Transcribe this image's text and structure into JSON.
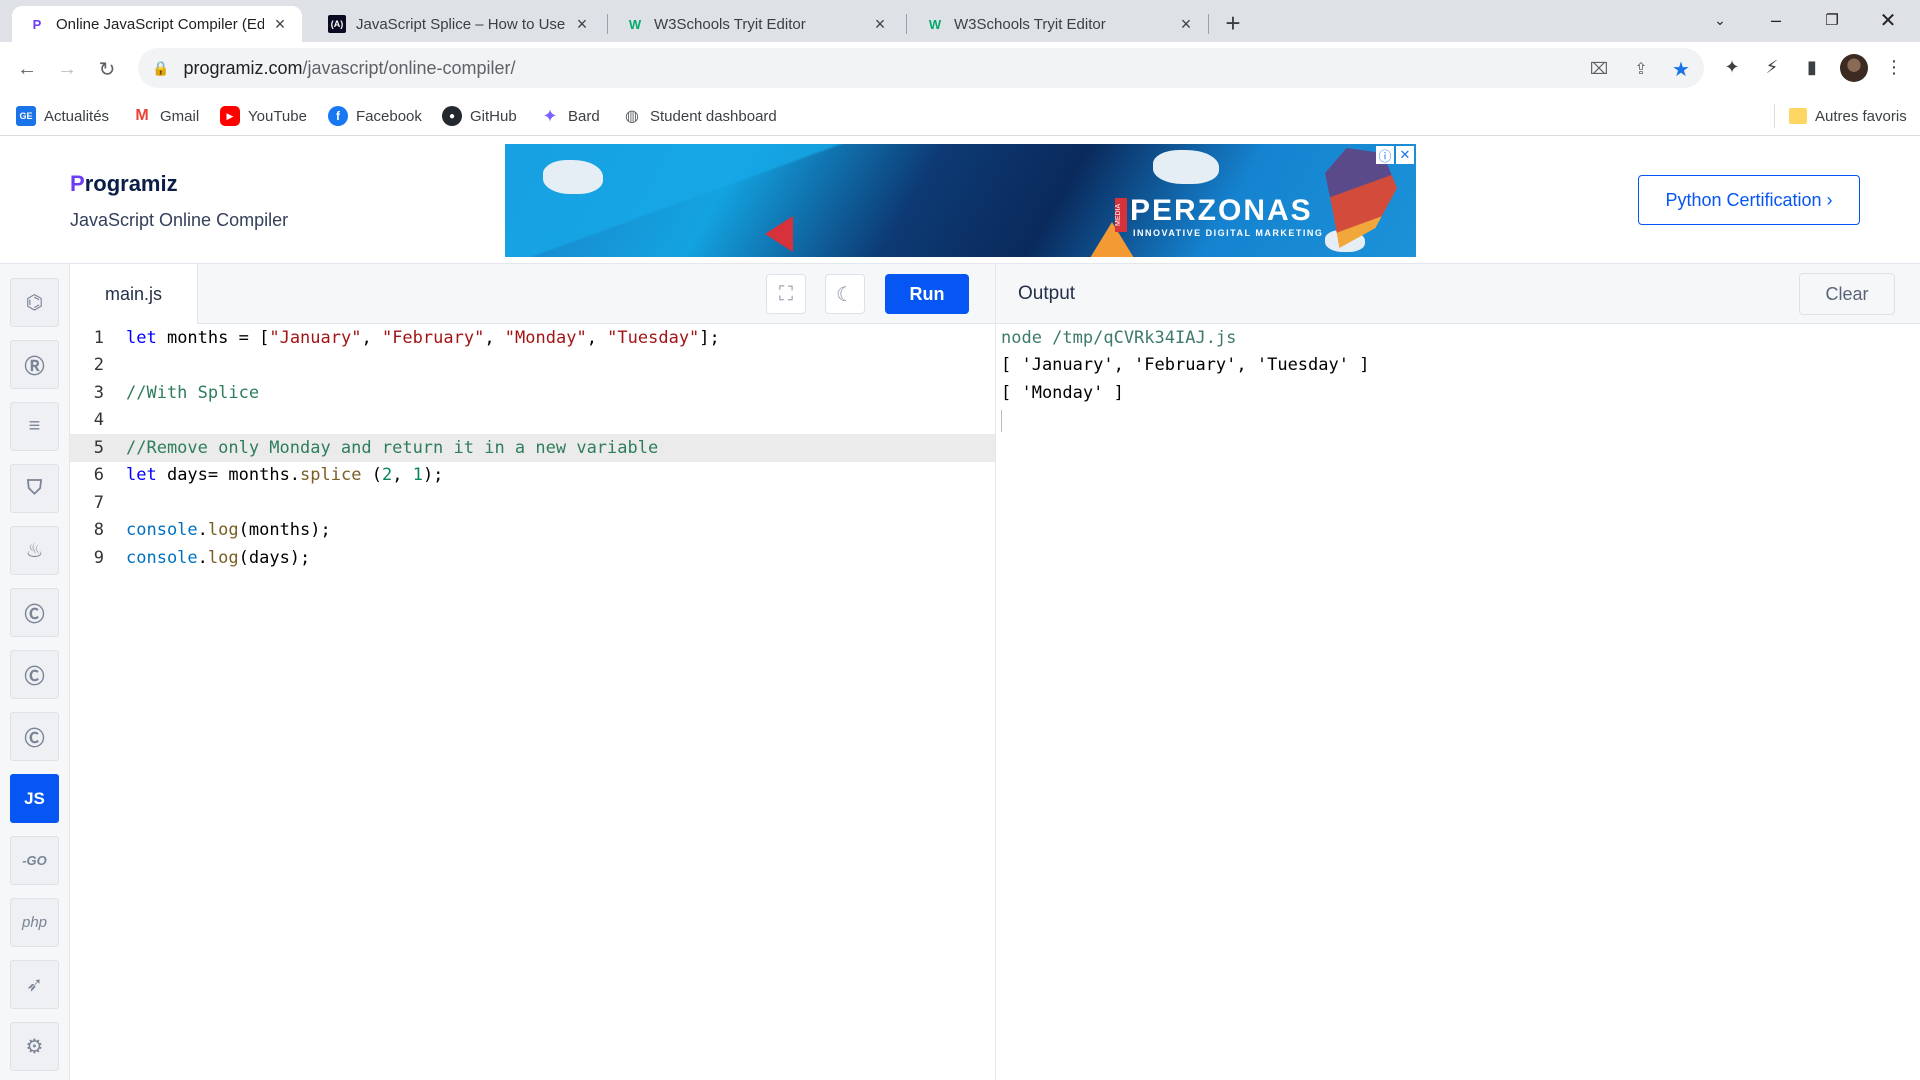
{
  "browser": {
    "tabs": [
      {
        "title": "Online JavaScript Compiler (Edito",
        "favicon": "P",
        "active": true
      },
      {
        "title": "JavaScript Splice – How to Use th",
        "favicon": "(A)",
        "active": false
      },
      {
        "title": "W3Schools Tryit Editor",
        "favicon": "W",
        "active": false
      },
      {
        "title": "W3Schools Tryit Editor",
        "favicon": "W",
        "active": false
      }
    ],
    "url_domain": "programiz.com",
    "url_path": "/javascript/online-compiler/",
    "bookmarks": [
      {
        "label": "Actualités",
        "icon": "news-icon",
        "color": "#1a73e8"
      },
      {
        "label": "Gmail",
        "icon": "gmail-icon",
        "color": "#ea4335"
      },
      {
        "label": "YouTube",
        "icon": "youtube-icon",
        "color": "#ff0000"
      },
      {
        "label": "Facebook",
        "icon": "facebook-icon",
        "color": "#1877f2"
      },
      {
        "label": "GitHub",
        "icon": "github-icon",
        "color": "#24292f"
      },
      {
        "label": "Bard",
        "icon": "bard-icon",
        "color": "#7b61ff"
      },
      {
        "label": "Student dashboard",
        "icon": "globe-icon",
        "color": "#5f6368"
      }
    ],
    "other_bookmarks": "Autres favoris"
  },
  "site": {
    "logo": "rogramiz",
    "logo_initial": "P",
    "subtitle": "JavaScript Online Compiler",
    "ad": {
      "brand": "PERZONAS",
      "tagline": "INNOVATIVE DIGITAL MARKETING",
      "media": "MEDIA"
    },
    "cert_button": "Python Certification ›"
  },
  "editor": {
    "file_name": "main.js",
    "run_label": "Run",
    "highlighted_line": 5,
    "lines": [
      "let months = [\"January\", \"February\", \"Monday\", \"Tuesday\"];",
      "",
      "//With Splice",
      "",
      "//Remove only Monday and return it in a new variable",
      "let days= months.splice (2, 1);",
      "",
      "console.log(months);",
      "console.log(days);"
    ]
  },
  "languages": [
    {
      "name": "python",
      "icon": "python-icon"
    },
    {
      "name": "r",
      "icon": "r-icon"
    },
    {
      "name": "sql",
      "icon": "database-icon"
    },
    {
      "name": "html",
      "icon": "html5-icon"
    },
    {
      "name": "java",
      "icon": "java-icon"
    },
    {
      "name": "c",
      "icon": "c-icon"
    },
    {
      "name": "cpp",
      "icon": "cpp-icon"
    },
    {
      "name": "csharp",
      "icon": "csharp-icon"
    },
    {
      "name": "js",
      "icon": "js-icon",
      "label": "JS",
      "active": true
    },
    {
      "name": "go",
      "icon": "go-icon",
      "label": "-GO"
    },
    {
      "name": "php",
      "icon": "php-icon",
      "label": "php"
    },
    {
      "name": "swift",
      "icon": "swift-icon"
    },
    {
      "name": "rust",
      "icon": "rust-icon"
    }
  ],
  "output": {
    "title": "Output",
    "clear_label": "Clear",
    "lines": [
      "node /tmp/qCVRk34IAJ.js",
      "[ 'January', 'February', 'Tuesday' ]",
      "[ 'Monday' ]"
    ]
  },
  "colors": {
    "accent": "#0556f3",
    "brand_purple": "#6c3df4"
  }
}
